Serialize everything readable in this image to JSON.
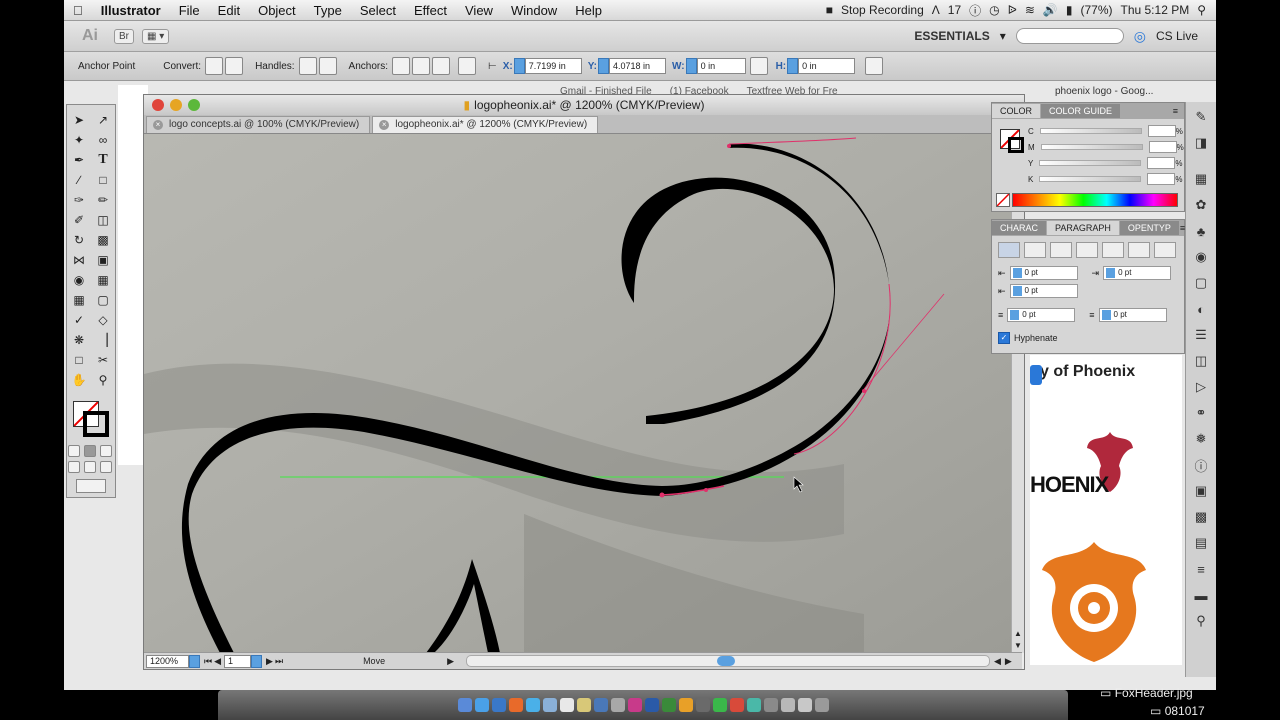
{
  "menubar": {
    "app": "Illustrator",
    "items": [
      "File",
      "Edit",
      "Object",
      "Type",
      "Select",
      "Effect",
      "View",
      "Window",
      "Help"
    ],
    "recording": "Stop Recording",
    "adobe_count": "17",
    "battery": "(77%)",
    "clock": "Thu 5:12 PM"
  },
  "appbar": {
    "logo": "Ai",
    "bridge": "Br",
    "workspace": "ESSENTIALS",
    "cslive": "CS Live"
  },
  "controlbar": {
    "label": "Anchor Point",
    "convert": "Convert:",
    "handles": "Handles:",
    "anchors": "Anchors:",
    "x_label": "X:",
    "x_value": "7.7199 in",
    "y_label": "Y:",
    "y_value": "4.0718 in",
    "w_label": "W:",
    "w_value": "0 in",
    "h_label": "H:",
    "h_value": "0 in"
  },
  "document": {
    "title": "logopheonix.ai* @ 1200% (CMYK/Preview)",
    "tabs": [
      {
        "label": "logo concepts.ai @ 100% (CMYK/Preview)"
      },
      {
        "label": "logopheonix.ai* @ 1200% (CMYK/Preview)"
      }
    ],
    "zoom": "1200%",
    "artboard": "1",
    "status": "Move"
  },
  "browser_tabs": [
    "Gmail - Finished File",
    "(1) Facebook",
    "Textfree Web for Fre",
    "phoenix logo - Goog..."
  ],
  "color_panel": {
    "tabs": [
      "COLOR",
      "COLOR GUIDE"
    ],
    "channels": [
      "C",
      "M",
      "Y",
      "K"
    ],
    "pct": "%"
  },
  "paragraph_panel": {
    "tabs": [
      "CHARAC",
      "PARAGRAPH",
      "OPENTYP"
    ],
    "fields": [
      "0 pt",
      "0 pt",
      "0 pt",
      "0 pt",
      "0 pt"
    ],
    "hyphenate": "Hyphenate"
  },
  "webpage": {
    "heading": "y of Phoenix",
    "logo_text": "HOENIX"
  },
  "dockright": {
    "file": "FoxHeader.jpg",
    "file2": "081017"
  },
  "colors": {
    "stroke": "#000000",
    "path_handle": "#e0306a",
    "guide": "#55dd55",
    "accent": "#2a78d8"
  }
}
